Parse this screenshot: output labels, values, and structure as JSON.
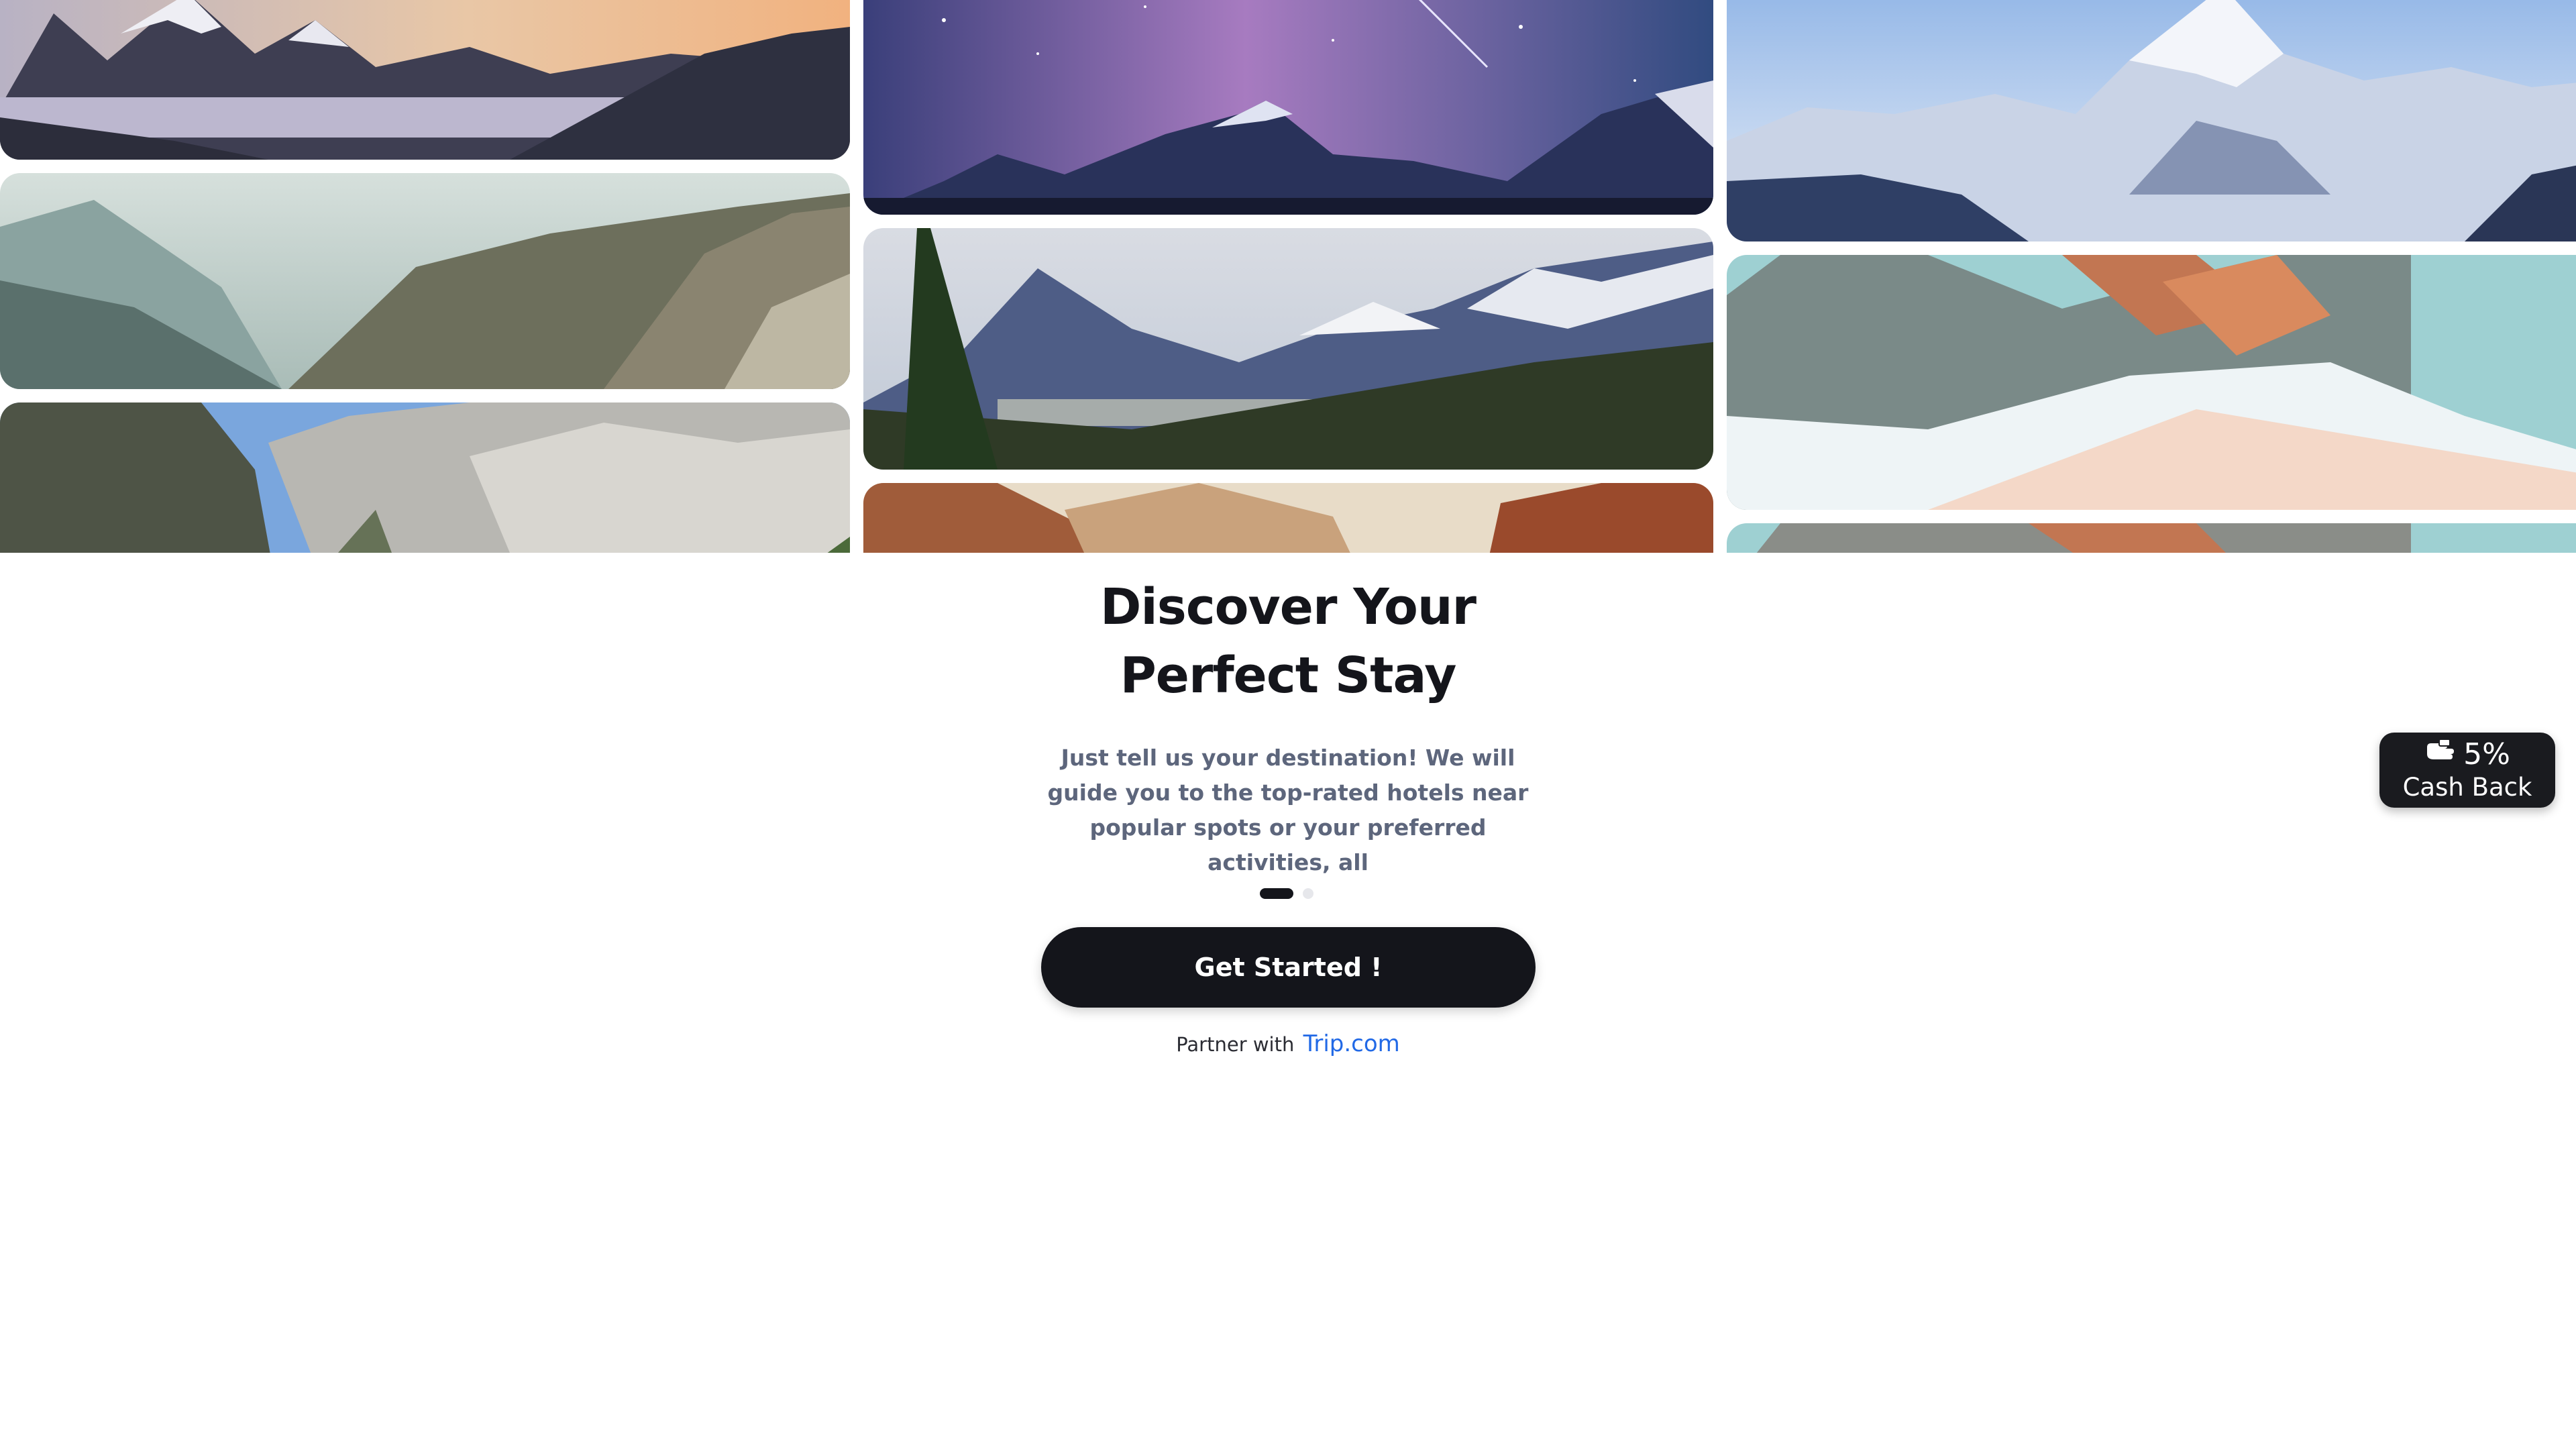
{
  "hero": {
    "title_line1": "Discover Your",
    "title_line2": "Perfect Stay",
    "subtitle": "Just tell us your destination! We will guide you to the top-rated hotels near popular spots or your preferred activities, all"
  },
  "pagination": {
    "active_index": 1,
    "total": 2
  },
  "cta": {
    "label": "Get Started !"
  },
  "partner": {
    "prefix": "Partner with",
    "brand": "Trip.com"
  },
  "promo": {
    "percent": "5%",
    "label": "Cash Back",
    "icon": "hand-money-icon"
  },
  "colors": {
    "primary": "#14151b",
    "link": "#2169e6",
    "subtitle": "#5d667c"
  }
}
